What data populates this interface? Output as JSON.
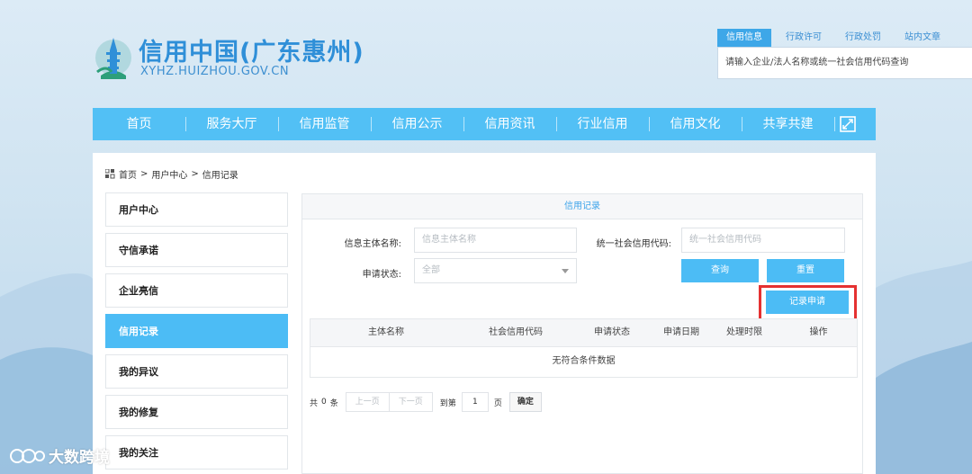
{
  "header": {
    "logo_title": "信用中国(广东惠州)",
    "logo_url": "XYHZ.HUIZHOU.GOV.CN",
    "search_tabs": [
      "信用信息",
      "行政许可",
      "行政处罚",
      "站内文章"
    ],
    "search_placeholder": "请输入企业/法人名称或统一社会信用代码查询"
  },
  "nav": {
    "items": [
      "首页",
      "服务大厅",
      "信用监管",
      "信用公示",
      "信用资讯",
      "行业信用",
      "信用文化",
      "共享共建"
    ],
    "expand_icon": "expand-icon"
  },
  "breadcrumb": {
    "home": "首页",
    "sep": ">",
    "level2": "用户中心",
    "level3": "信用记录"
  },
  "sidebar": {
    "items": [
      "用户中心",
      "守信承诺",
      "企业亮信",
      "信用记录",
      "我的异议",
      "我的修复",
      "我的关注"
    ],
    "active": "信用记录"
  },
  "content": {
    "title": "信用记录",
    "form": {
      "subject_label": "信息主体名称:",
      "subject_placeholder": "信息主体名称",
      "code_label": "统一社会信用代码:",
      "code_placeholder": "统一社会信用代码",
      "status_label": "申请状态:",
      "status_value": "全部"
    },
    "buttons": {
      "query": "查询",
      "reset": "重置",
      "apply": "记录申请"
    },
    "table": {
      "headers": [
        "主体名称",
        "社会信用代码",
        "申请状态",
        "申请日期",
        "处理时限",
        "操作"
      ],
      "empty_text": "无符合条件数据"
    },
    "pager": {
      "total_prefix": "共",
      "total": "0",
      "total_suffix": "条",
      "prev": "上一页",
      "next": "下一页",
      "goto_prefix": "到第",
      "page_value": "1",
      "goto_suffix": "页",
      "confirm": "确定"
    }
  },
  "watermark": {
    "text": "大数跨境"
  },
  "colors": {
    "accent": "#4cbcf5",
    "highlight": "#e53131",
    "brand": "#2f8fd8"
  }
}
